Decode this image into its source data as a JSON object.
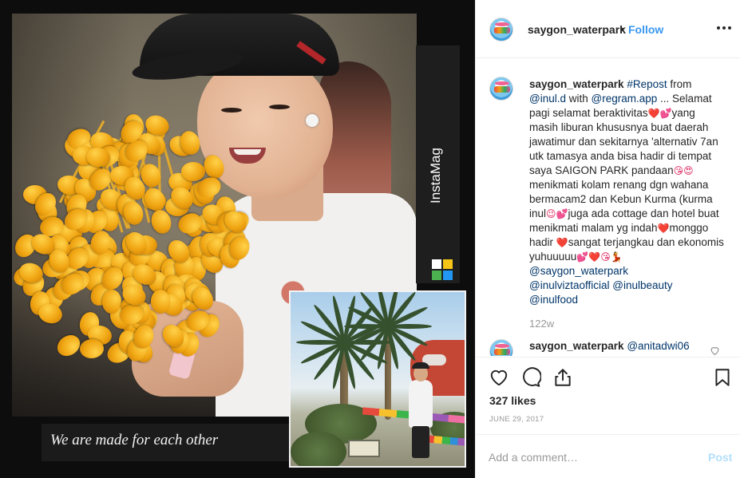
{
  "post": {
    "username": "saygon_waterpark",
    "dot": "•",
    "follow_label": "Follow",
    "image_caption": "We are made for each other",
    "watermark": "InstaMag",
    "caption": {
      "username": "saygon_waterpark",
      "hashtag": "#Repost",
      "from_text": "from",
      "mention_1": "@inul.d",
      "with_text": "with",
      "mention_2": "@regram.app",
      "body_1": "... Selamat pagi selamat beraktivitas",
      "emoji_1": "❤️💕",
      "body_2": "yang masih liburan khususnya buat daerah jawatimur dan sekitarnya 'alternativ 7an utk tamasya anda bisa hadir di tempat saya SAIGON PARK pandaan",
      "emoji_2": "😘😍",
      "body_3": "menikmati kolam renang dgn wahana bermacam2 dan Kebun Kurma (kurma inul",
      "emoji_3": "😉💕",
      "body_4": "juga ada cottage dan hotel buat menikmati malam yg indah",
      "emoji_4": "❤️",
      "body_5": "monggo hadir",
      "emoji_5": "❤️",
      "body_6": "sangat terjangkau dan ekonomis yuhuuuuu",
      "emoji_6": "💕❤️😘💃",
      "mention_3": "@saygon_waterpark",
      "mention_4": "@inulviztaofficial",
      "mention_5": "@inulbeauty",
      "mention_6": "@inulfood",
      "time": "122w"
    },
    "comment_2": {
      "username": "saygon_waterpark",
      "mention": "@anitadwi06"
    },
    "likes": "327 likes",
    "date": "JUNE 29, 2017",
    "comment_placeholder": "Add a comment…",
    "post_label": "Post"
  },
  "icons": {
    "like": "heart-outline-icon",
    "comment": "speech-bubble-icon",
    "share": "share-arrow-icon",
    "save": "bookmark-icon",
    "more": "ellipsis-icon",
    "comment_like": "small-heart-icon"
  },
  "colors": {
    "link": "#003569",
    "follow": "#3897f0",
    "post_disabled": "#b2dffc",
    "muted": "#999999",
    "text": "#262626"
  }
}
